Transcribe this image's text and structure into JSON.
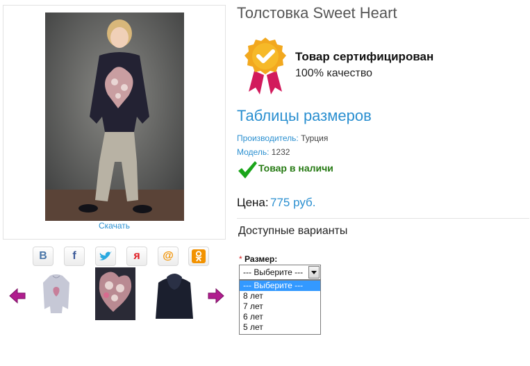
{
  "gallery": {
    "download_label": "Скачать",
    "share_icons": [
      "vk-icon",
      "facebook-icon",
      "twitter-icon",
      "yaru-icon",
      "mailru-icon",
      "odnoklassniki-icon"
    ],
    "share_letters": [
      "В",
      "f",
      "",
      "я",
      "@",
      ""
    ]
  },
  "product": {
    "title": "Толстовка Sweet Heart",
    "certificate_title": "Товар сертифицирован",
    "certificate_subtitle": "100% качество",
    "size_table_link": "Таблицы размеров",
    "manufacturer_label": "Производитель:",
    "manufacturer_value": "Турция",
    "model_label": "Модель:",
    "model_value": "1232",
    "stock_status": "Товар в наличи",
    "price_label": "Цена:",
    "price_value": "775 руб.",
    "variants_heading": "Доступные варианты"
  },
  "size_select": {
    "required_mark": "*",
    "label": "Размер:",
    "selected": "--- Выберите ---",
    "options": [
      "--- Выберите ---",
      "8 лет",
      "7 лет",
      "6 лет",
      "5 лет"
    ]
  },
  "colors": {
    "link": "#2a8fd0",
    "stock_green": "#267a13",
    "option_highlight": "#3399ff",
    "arrow_purple": "#b01d8e"
  }
}
